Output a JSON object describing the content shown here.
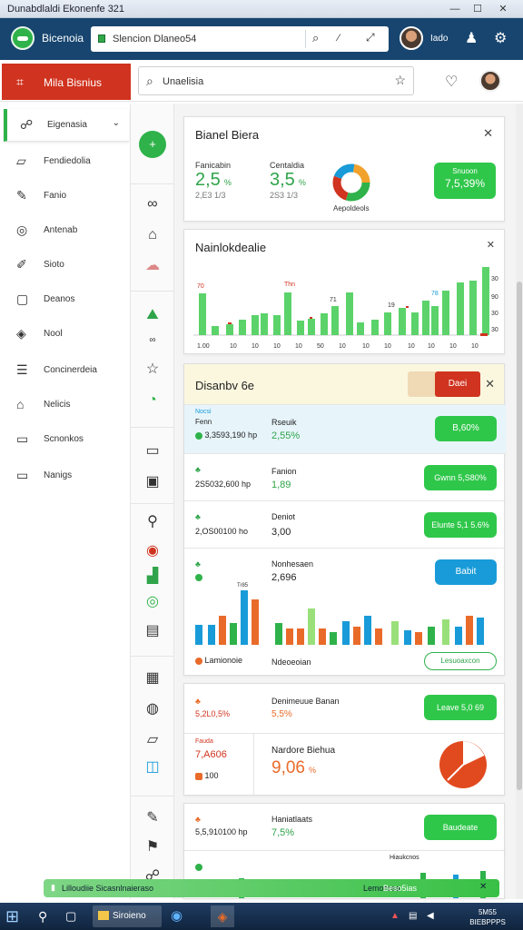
{
  "window": {
    "title": "Dunabdlaldi Ekonenfe 321",
    "minimize": "—",
    "maximize": "☐",
    "close": "✕"
  },
  "appbar": {
    "app_name": "Bicenoia",
    "search_placeholder": "Slencion Dlaneo54",
    "user_name": "Iado"
  },
  "subbar": {
    "brand_title": "Mila Bisnius",
    "search_text": "Unaelisia"
  },
  "sidebar": {
    "items": [
      {
        "label": "Eigenasia",
        "icon": "chat-icon"
      },
      {
        "label": "Fendiedolia",
        "icon": "folder-icon"
      },
      {
        "label": "Fanio",
        "icon": "edit-icon"
      },
      {
        "label": "Antenab",
        "icon": "target-icon"
      },
      {
        "label": "Sioto",
        "icon": "pen-icon"
      },
      {
        "label": "Deanos",
        "icon": "clipboard-icon"
      },
      {
        "label": "Nool",
        "icon": "tag-icon"
      },
      {
        "label": "Concinerdeia",
        "icon": "list-icon"
      },
      {
        "label": "Nelicis",
        "icon": "home-icon"
      },
      {
        "label": "Scnonkos",
        "icon": "document-icon"
      },
      {
        "label": "Nanigs",
        "icon": "tab-icon"
      }
    ]
  },
  "rail": {
    "fab_label": "+"
  },
  "card1": {
    "title": "Bianel Biera",
    "stat1": {
      "label": "Fanicabin",
      "value": "2,5",
      "pct": "%",
      "sub": "2,E3 1/3"
    },
    "stat2": {
      "label": "Centaldia",
      "value": "3,5",
      "pct": "%",
      "sub": "2S3 1/3"
    },
    "donut_label": "Aepoldeols",
    "button": "7,5,39%",
    "button_top": "Snuoon"
  },
  "card2": {
    "title": "Nainlokdealie",
    "right_ticks": [
      "30",
      "90",
      "30",
      "30"
    ],
    "x_labels": [
      "1.00",
      "10",
      "10",
      "10",
      "10",
      "50",
      "10",
      "10",
      "10",
      "10",
      "10",
      "10",
      "10"
    ],
    "markers": [
      "70",
      "Thn",
      "71",
      "19",
      "78"
    ]
  },
  "card3": {
    "title": "Disanbv 6e",
    "header_button": "Daei",
    "rows": [
      {
        "label_top": "Nocsi",
        "label": "Fenn",
        "left": "3,3593,190 hp",
        "name": "Rseuik",
        "value": "2,55%",
        "button": "B,60%"
      },
      {
        "label_top": "",
        "label": "",
        "left": "2S5032,600 hp",
        "name": "Fanion",
        "value": "1,89",
        "button": "Gwnn 5,S80%"
      },
      {
        "label_top": "",
        "label": "",
        "left": "2,OS00100 ho",
        "name": "Deniot",
        "value": "3,00",
        "button": "Elunte 5,1 5.6%"
      },
      {
        "label_top": "",
        "label": "",
        "left": "",
        "name": "Nonhesaen",
        "value": "2,696",
        "button": "Babit"
      }
    ],
    "chart_footer_left": "Lamionoie",
    "chart_footer_mid": "Ndeoeoian",
    "chart_footer_btn": "Lesuoaxcon",
    "chart_marker": "Tr85"
  },
  "card4": {
    "name": "Denimeuue Banan",
    "value": "5,5%",
    "left_value": "5,2L0,5%",
    "button": "Leave 5,0 69",
    "label2": "Fauda",
    "value2": "7,A606",
    "small2": "100",
    "name2": "Nardore Biehua",
    "big2": "9,06",
    "pct2": "%"
  },
  "card5": {
    "left": "5,5,910100 hp",
    "name": "Haniatlaats",
    "value": "7,5%",
    "button": "Baudeate"
  },
  "card6": {
    "label1": "Hiaukcnos",
    "label2": "Baaoneelaiat"
  },
  "status_strip": {
    "text": "Lilloudiie Sicasnlnaieraso",
    "right": "Lemoorea",
    "right2": "Beso5ias"
  },
  "taskbar": {
    "start": "⊞",
    "item1": "Siroieno",
    "time": "5M55",
    "date": "BIEBPPPS"
  },
  "colors": {
    "green": "#2fb24a",
    "red": "#d0331f",
    "blue": "#17456f",
    "orange": "#e96b2a",
    "teal": "#189bd8"
  }
}
